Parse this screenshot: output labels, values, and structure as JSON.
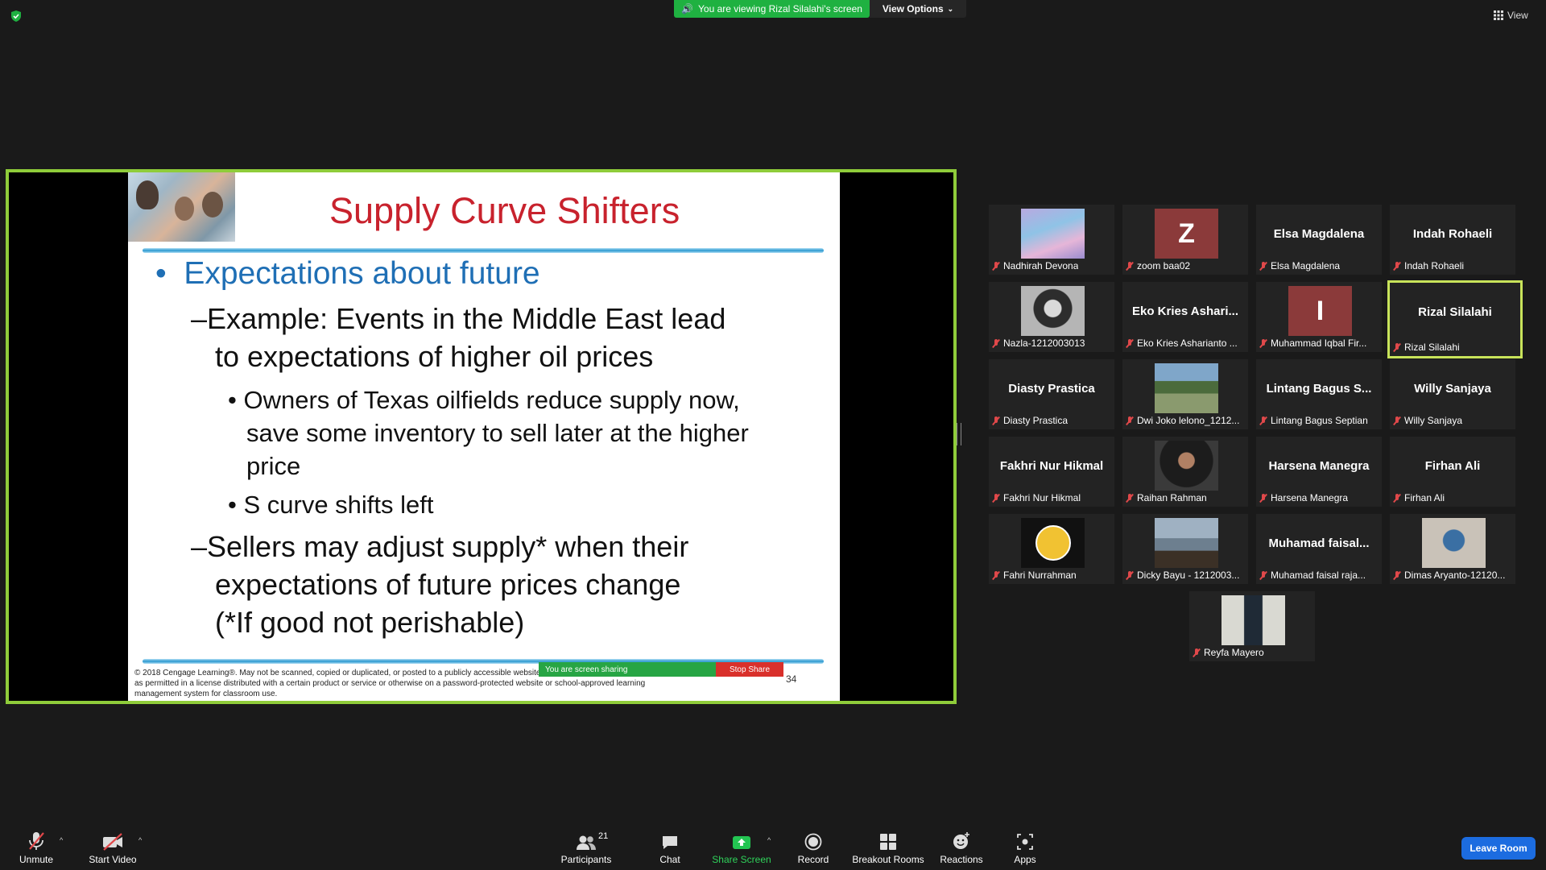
{
  "banner": {
    "text": "You are viewing Rizal Silalahi's screen",
    "view_options": "View Options"
  },
  "view_label": "View",
  "slide": {
    "title": "Supply Curve Shifters",
    "bullet1": "Expectations about future",
    "dash1_line1": "–Example: Events in the Middle East lead",
    "dash1_line2": "to expectations of higher oil prices",
    "sub1_line1": "Owners of Texas oilfields reduce supply now,",
    "sub1_line2": "save some inventory to sell later at the higher",
    "sub1_line3": "price",
    "sub2": "S curve shifts left",
    "dash2_line1": "–Sellers may adjust supply* when their",
    "dash2_line2": "expectations of future prices change",
    "dash2_line3": "(*If good not perishable)",
    "footer_line1": "© 2018 Cengage Learning®. May not be scanned, copied or duplicated, or posted to a publicly accessible website, in whole or in part, except for use",
    "footer_line2": "as permitted in a license distributed with a certain product or service or otherwise on a password-protected website or school-approved learning",
    "footer_line3": "management system for classroom use.",
    "page": "34",
    "sharing_text": "You are screen sharing",
    "stop_share": "Stop Share"
  },
  "participants": [
    {
      "display": "",
      "name": "Nadhirah Devona",
      "avatar": "landscape"
    },
    {
      "display": "Z",
      "name": "zoom baa02",
      "avatar": "letter",
      "color": "#8b3a3a"
    },
    {
      "display": "Elsa Magdalena",
      "name": "Elsa Magdalena"
    },
    {
      "display": "Indah Rohaeli",
      "name": "Indah Rohaeli"
    },
    {
      "display": "",
      "name": "Nazla-1212003013",
      "avatar": "photo-bw"
    },
    {
      "display": "Eko Kries Ashari...",
      "name": "Eko Kries Asharianto ..."
    },
    {
      "display": "I",
      "name": "Muhammad Iqbal Fir...",
      "avatar": "letter",
      "color": "#8b3a3a"
    },
    {
      "display": "Rizal Silalahi",
      "name": "Rizal Silalahi",
      "active": true
    },
    {
      "display": "Diasty Prastica",
      "name": "Diasty Prastica"
    },
    {
      "display": "",
      "name": "Dwi Joko lelono_1212...",
      "avatar": "photo-park"
    },
    {
      "display": "Lintang Bagus S...",
      "name": "Lintang Bagus Septian"
    },
    {
      "display": "Willy Sanjaya",
      "name": "Willy Sanjaya"
    },
    {
      "display": "Fakhri Nur Hikmal",
      "name": "Fakhri Nur Hikmal"
    },
    {
      "display": "",
      "name": "Raihan Rahman",
      "avatar": "photo-man"
    },
    {
      "display": "Harsena Manegra",
      "name": "Harsena Manegra"
    },
    {
      "display": "Firhan Ali",
      "name": "Firhan Ali"
    },
    {
      "display": "",
      "name": "Fahri Nurrahman",
      "avatar": "cartoon"
    },
    {
      "display": "",
      "name": "Dicky Bayu - 1212003...",
      "avatar": "photo-beach"
    },
    {
      "display": "Muhamad  faisal...",
      "name": "Muhamad faisal raja..."
    },
    {
      "display": "",
      "name": "Dimas Aryanto-12120...",
      "avatar": "photo-sit"
    },
    {
      "display": "",
      "name": "Reyfa Mayero",
      "avatar": "photo-stand"
    }
  ],
  "toolbar": {
    "unmute": "Unmute",
    "start_video": "Start Video",
    "participants": "Participants",
    "participants_count": "21",
    "chat": "Chat",
    "share_screen": "Share Screen",
    "record": "Record",
    "breakout": "Breakout Rooms",
    "reactions": "Reactions",
    "apps": "Apps",
    "leave": "Leave Room"
  },
  "colors": {
    "share_border": "#8fcc3a",
    "banner_green": "#1fb141",
    "leave_blue": "#1c6ce0",
    "active_tile": "#c8e35a",
    "mic_muted": "#e0484a"
  }
}
